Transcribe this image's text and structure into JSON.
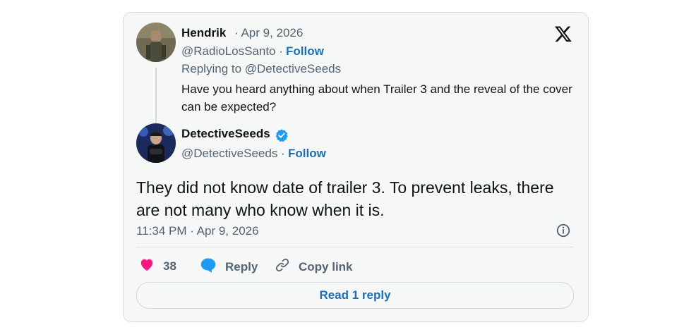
{
  "reply": {
    "name": "Hendrik",
    "date": "· Apr 9, 2026",
    "handle": "@RadioLosSanto ·",
    "follow": "Follow",
    "replying_to": "Replying to @DetectiveSeeds",
    "text": "Have you heard anything about when Trailer 3 and the reveal of the cover can be expected?"
  },
  "tweet": {
    "name": "DetectiveSeeds",
    "handle": "@DetectiveSeeds ·",
    "follow": "Follow",
    "text": "They did not know date of trailer 3. To prevent leaks, there are not many who know when it is.",
    "timestamp": "11:34 PM · Apr 9, 2026"
  },
  "actions": {
    "likes": "38",
    "reply_label": "Reply",
    "copy_label": "Copy link",
    "read_replies": "Read 1 reply"
  },
  "colors": {
    "heart": "#f91880",
    "reply_icon": "#1d9bf0",
    "link": "#1d6fb3",
    "verified": "#1d9bf0"
  },
  "icons": [
    "x-logo-icon",
    "verified-badge-icon",
    "heart-icon",
    "reply-bubble-icon",
    "link-icon",
    "info-icon"
  ]
}
